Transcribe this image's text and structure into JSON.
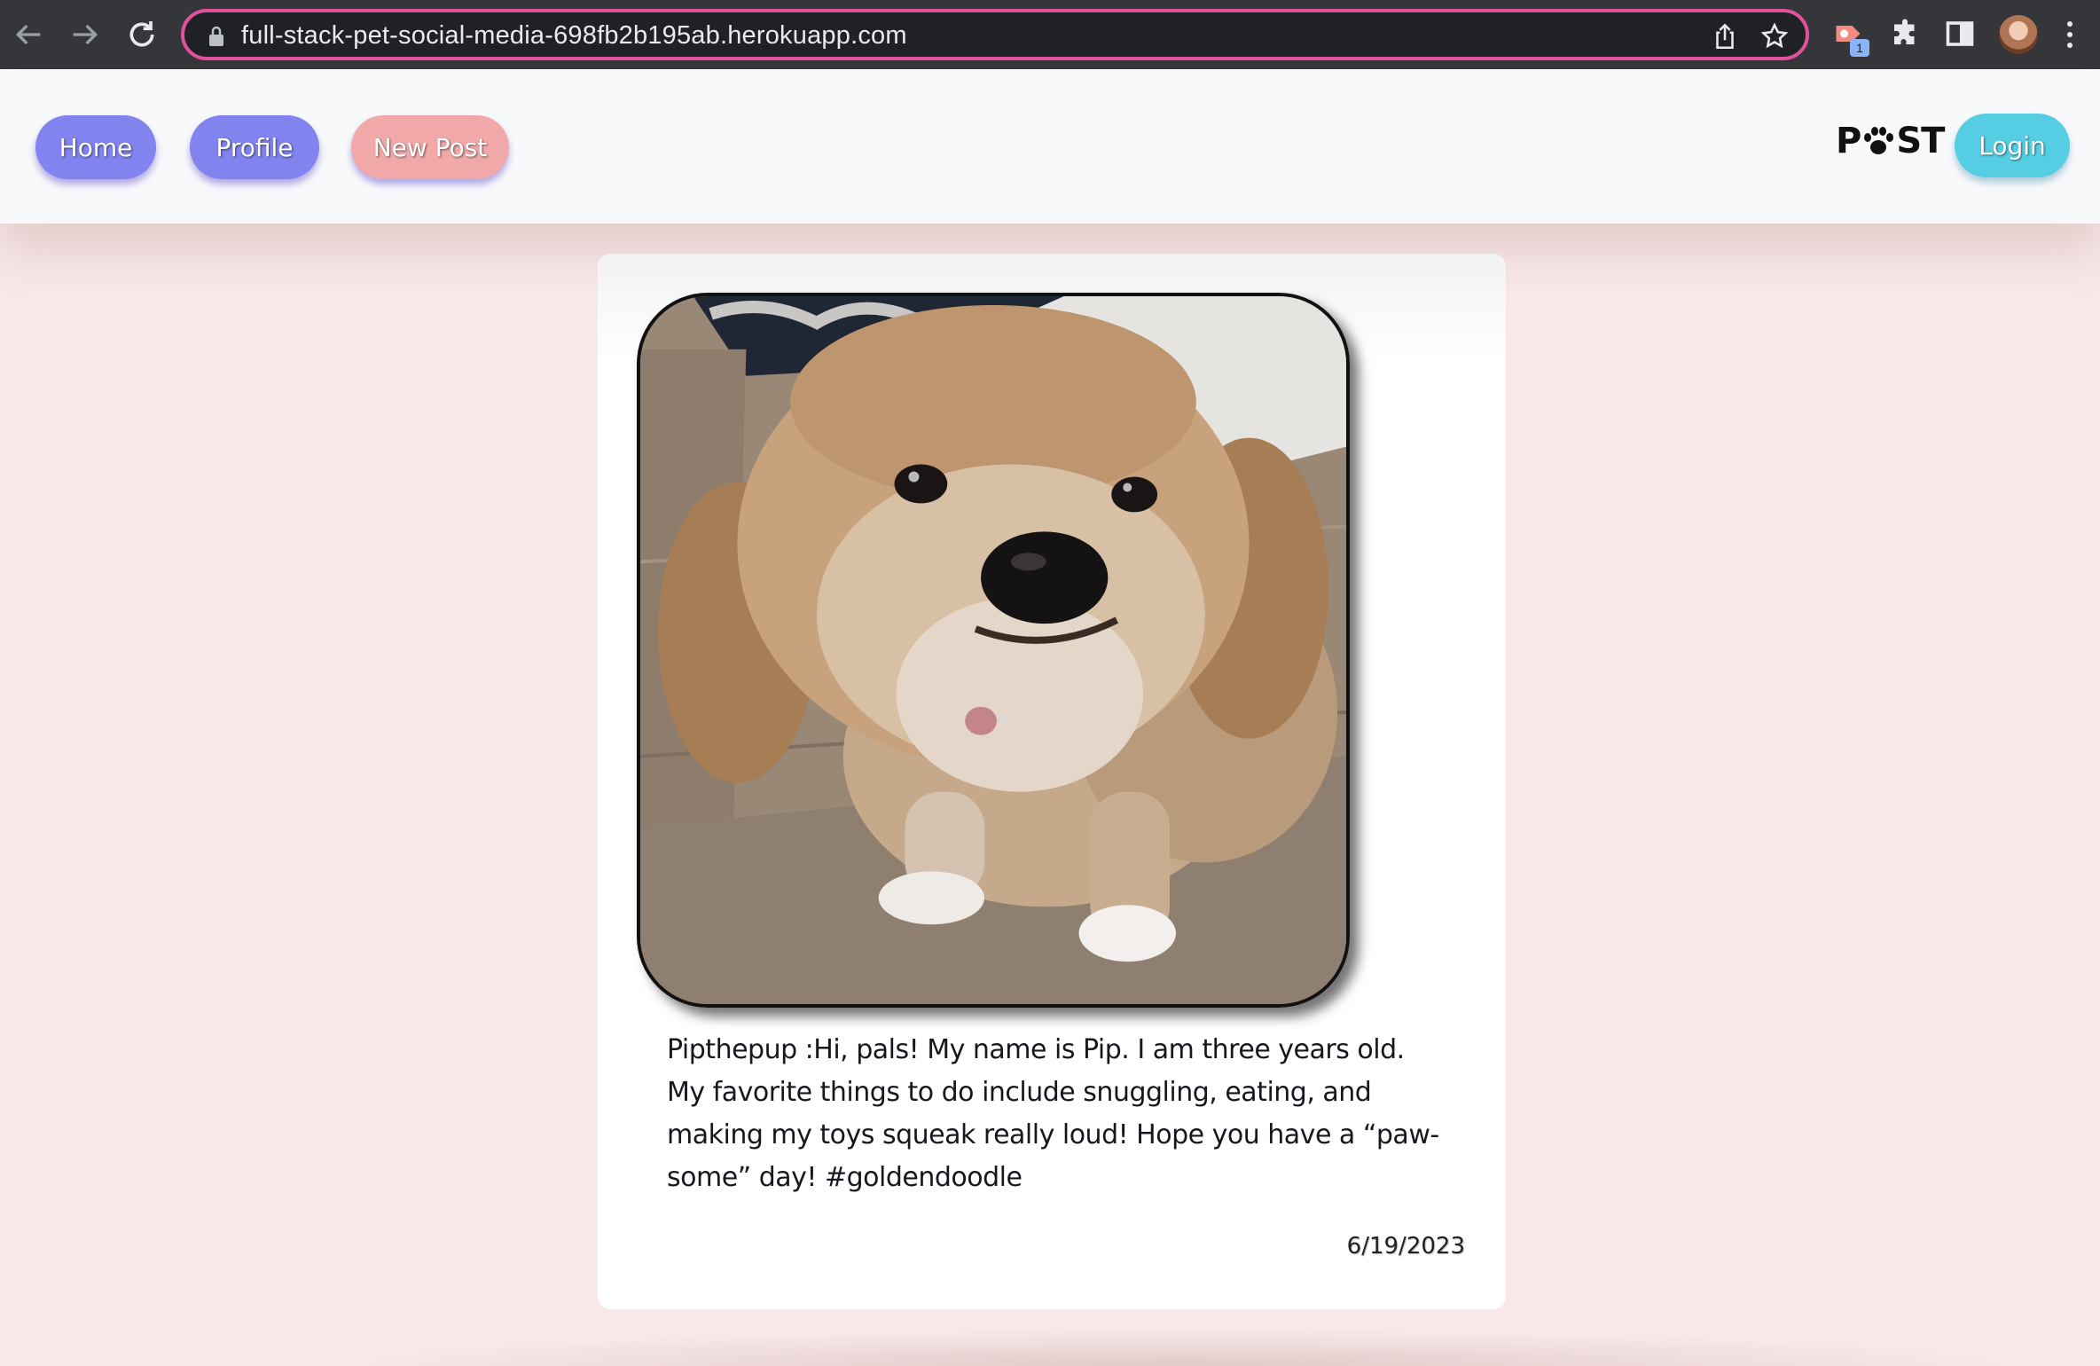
{
  "browser": {
    "url": "full-stack-pet-social-media-698fb2b195ab.herokuapp.com",
    "extension_badge": "1"
  },
  "nav": {
    "home_label": "Home",
    "profile_label": "Profile",
    "new_post_label": "New Post",
    "login_label": "Login",
    "logo_left": "P",
    "logo_right": "ST"
  },
  "post": {
    "caption": "Pipthepup :Hi, pals! My name is Pip. I am three years old. My favorite things to do include snuggling, eating, and making my toys squeak really loud! Hope you have a “paw-some” day! #goldendoodle",
    "date": "6/19/2023"
  },
  "colors": {
    "page_bg": "#f9e8e8",
    "nav_button": "#8183ee",
    "new_post_button": "#f0a9a8",
    "login_button": "#55cde3",
    "omnibox_border": "#e0529c"
  },
  "icons": [
    "back-arrow-icon",
    "forward-arrow-icon",
    "reload-icon",
    "lock-icon",
    "share-icon",
    "bookmark-star-icon",
    "extension-icon",
    "puzzle-icon",
    "side-panel-icon",
    "menu-dots-icon",
    "paw-icon"
  ]
}
